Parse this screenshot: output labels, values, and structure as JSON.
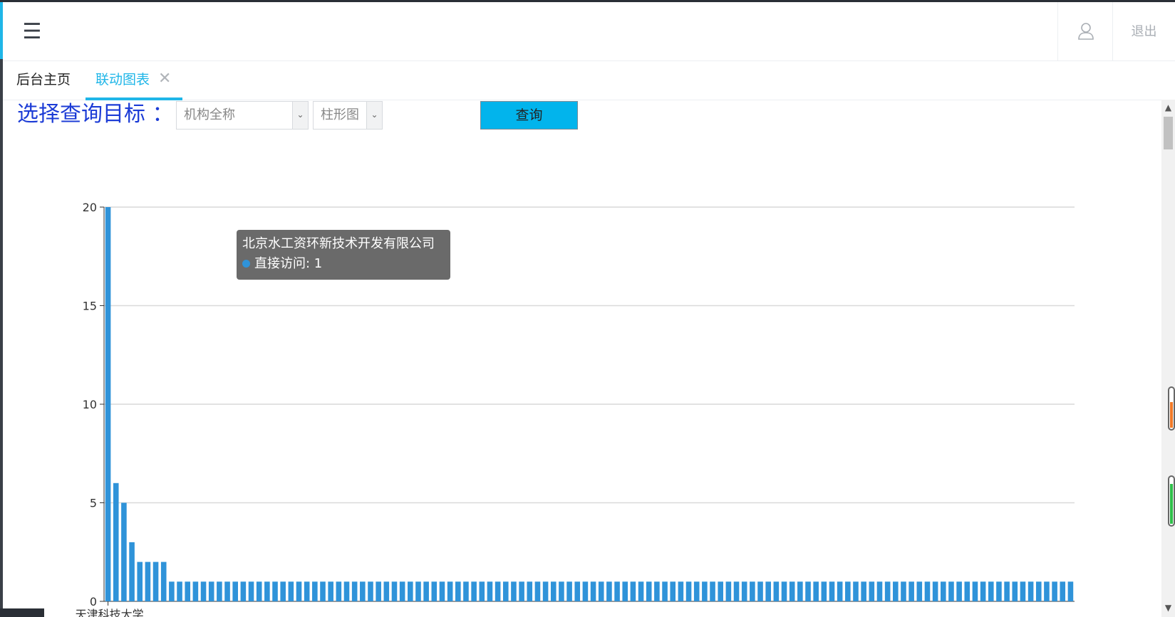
{
  "header": {
    "menu_icon": "☰",
    "user_icon": "user-icon",
    "logout_label": "退出"
  },
  "tabs": [
    {
      "label": "后台主页",
      "active": false
    },
    {
      "label": "联动图表",
      "active": true,
      "closable": true
    }
  ],
  "query": {
    "label": "选择查询目标 ：",
    "org_select_value": "机构全称",
    "type_select_value": "柱形图",
    "button_label": "查询"
  },
  "tooltip": {
    "title": "北京水工资环新技术开发有限公司",
    "series_name": "直接访问",
    "value_text": "直接访问: 1"
  },
  "colors": {
    "accent": "#1fb6e8",
    "bar": "#2f93d9",
    "query_label": "#1c3cd6",
    "query_button": "#02b4ec"
  },
  "chart_data": {
    "type": "bar",
    "ylim": [
      0,
      20
    ],
    "yticks": [
      0,
      5,
      10,
      15,
      20
    ],
    "grid": true,
    "visible_category_label": "天津科技大学",
    "series": [
      {
        "name": "直接访问",
        "values": [
          20,
          6,
          5,
          3,
          2,
          2,
          2,
          2,
          1,
          1,
          1,
          1,
          1,
          1,
          1,
          1,
          1,
          1,
          1,
          1,
          1,
          1,
          1,
          1,
          1,
          1,
          1,
          1,
          1,
          1,
          1,
          1,
          1,
          1,
          1,
          1,
          1,
          1,
          1,
          1,
          1,
          1,
          1,
          1,
          1,
          1,
          1,
          1,
          1,
          1,
          1,
          1,
          1,
          1,
          1,
          1,
          1,
          1,
          1,
          1,
          1,
          1,
          1,
          1,
          1,
          1,
          1,
          1,
          1,
          1,
          1,
          1,
          1,
          1,
          1,
          1,
          1,
          1,
          1,
          1,
          1,
          1,
          1,
          1,
          1,
          1,
          1,
          1,
          1,
          1,
          1,
          1,
          1,
          1,
          1,
          1,
          1,
          1,
          1,
          1,
          1,
          1,
          1,
          1,
          1,
          1,
          1,
          1,
          1,
          1,
          1,
          1,
          1,
          1,
          1,
          1,
          1,
          1,
          1,
          1,
          1,
          1
        ]
      }
    ]
  }
}
